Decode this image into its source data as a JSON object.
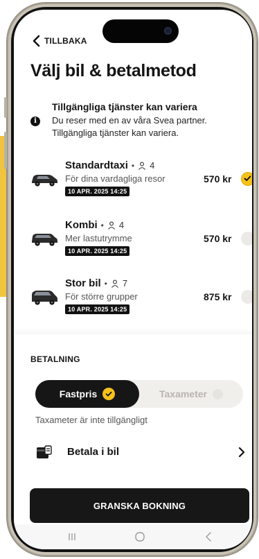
{
  "header": {
    "back_label": "TILLBAKA",
    "title": "Välj bil & betalmetod"
  },
  "info": {
    "icon": "info-icon",
    "title": "Tillgängliga tjänster kan variera",
    "text": "Du reser med en av våra Svea partner. Tillgängliga tjänster kan variera."
  },
  "vehicles": [
    {
      "name": "Standardtaxi",
      "separator": "•",
      "passengers": "4",
      "description": "För dina vardagliga resor",
      "date": "10 APR. 2025 14:25",
      "price": "570 kr",
      "selected": true
    },
    {
      "name": "Kombi",
      "separator": "•",
      "passengers": "4",
      "description": "Mer lastutrymme",
      "date": "10 APR. 2025 14:25",
      "price": "570 kr",
      "selected": false
    },
    {
      "name": "Stor bil",
      "separator": "•",
      "passengers": "7",
      "description": "För större grupper",
      "date": "10 APR. 2025 14:25",
      "price": "875 kr",
      "selected": false
    }
  ],
  "payment": {
    "heading": "BETALNING",
    "options": [
      {
        "label": "Fastpris",
        "selected": true
      },
      {
        "label": "Taxameter",
        "selected": false
      }
    ],
    "note": "Taxameter är inte tillgängligt",
    "method_label": "Betala i bil",
    "cta_label": "GRANSKA BOKNING"
  },
  "colors": {
    "accent": "#f5c21b",
    "dark": "#161616",
    "side_accent": "#f0c43f"
  }
}
